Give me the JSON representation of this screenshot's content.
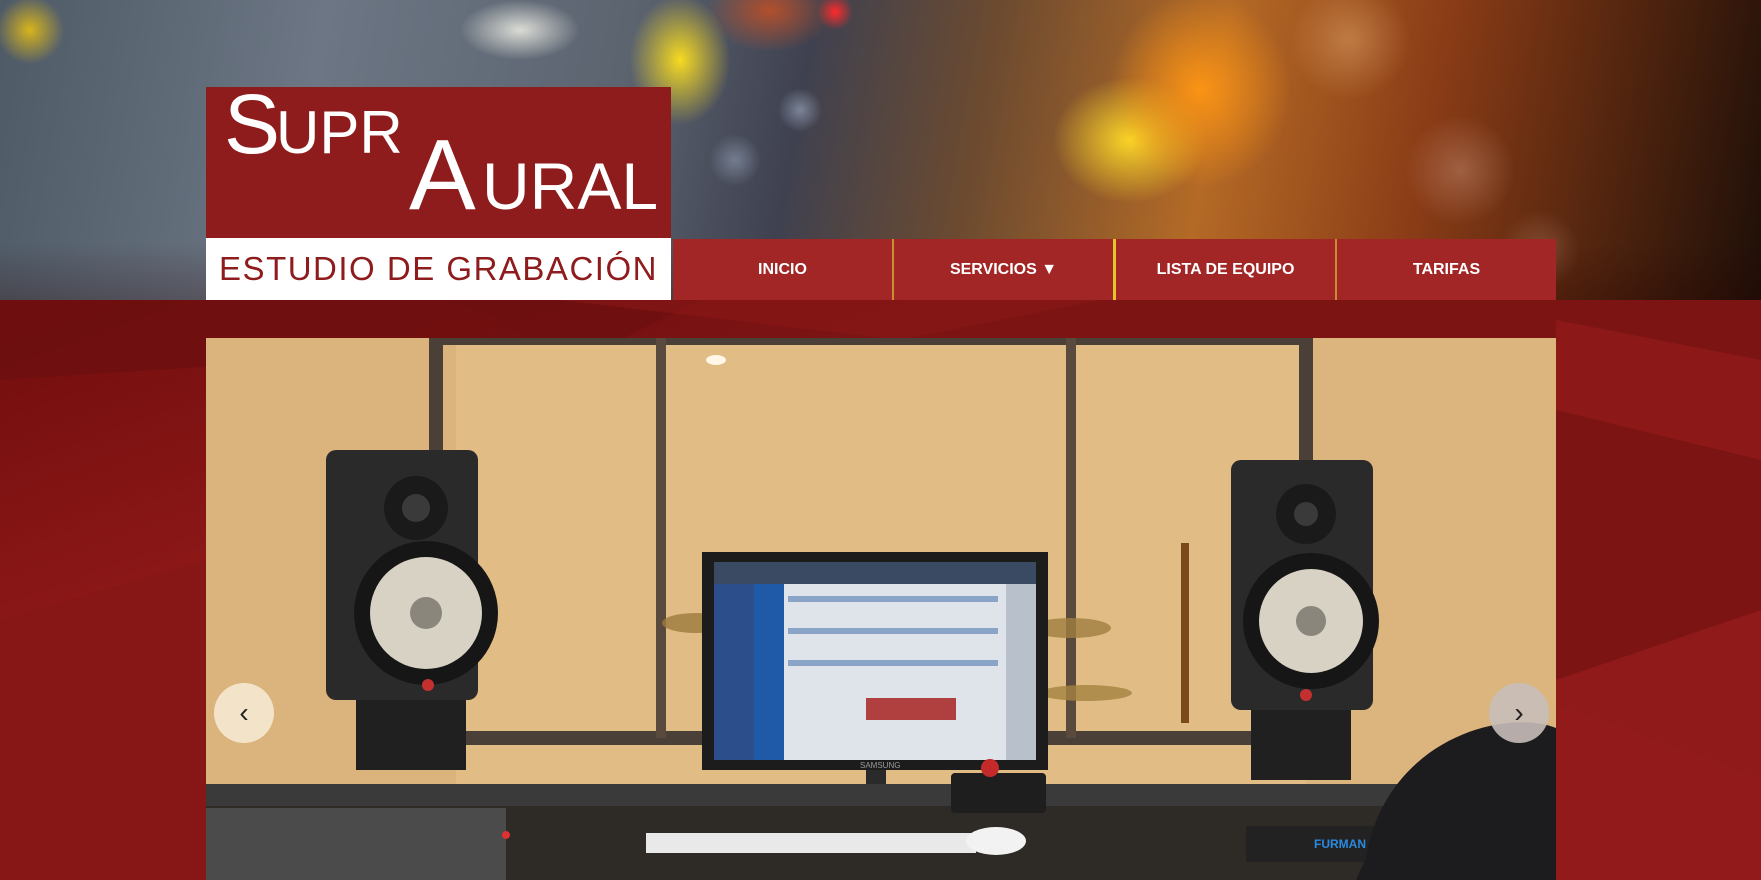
{
  "logo": {
    "name_part1": "Supr",
    "name_part2": "Aural",
    "tagline": "ESTUDIO DE GRABACIÓN"
  },
  "nav": {
    "items": [
      {
        "label": "INICIO"
      },
      {
        "label": "SERVICIOS ▼"
      },
      {
        "label": "LISTA DE EQUIPO"
      },
      {
        "label": "TARIFAS"
      }
    ]
  },
  "slider": {
    "prev_label": "‹",
    "next_label": "›",
    "monitor_brand": "SAMSUNG",
    "rack_brand": "FURMAN"
  },
  "colors": {
    "brand_red": "#8e1c1c",
    "nav_red": "#a32626",
    "background": "#7a1414"
  }
}
